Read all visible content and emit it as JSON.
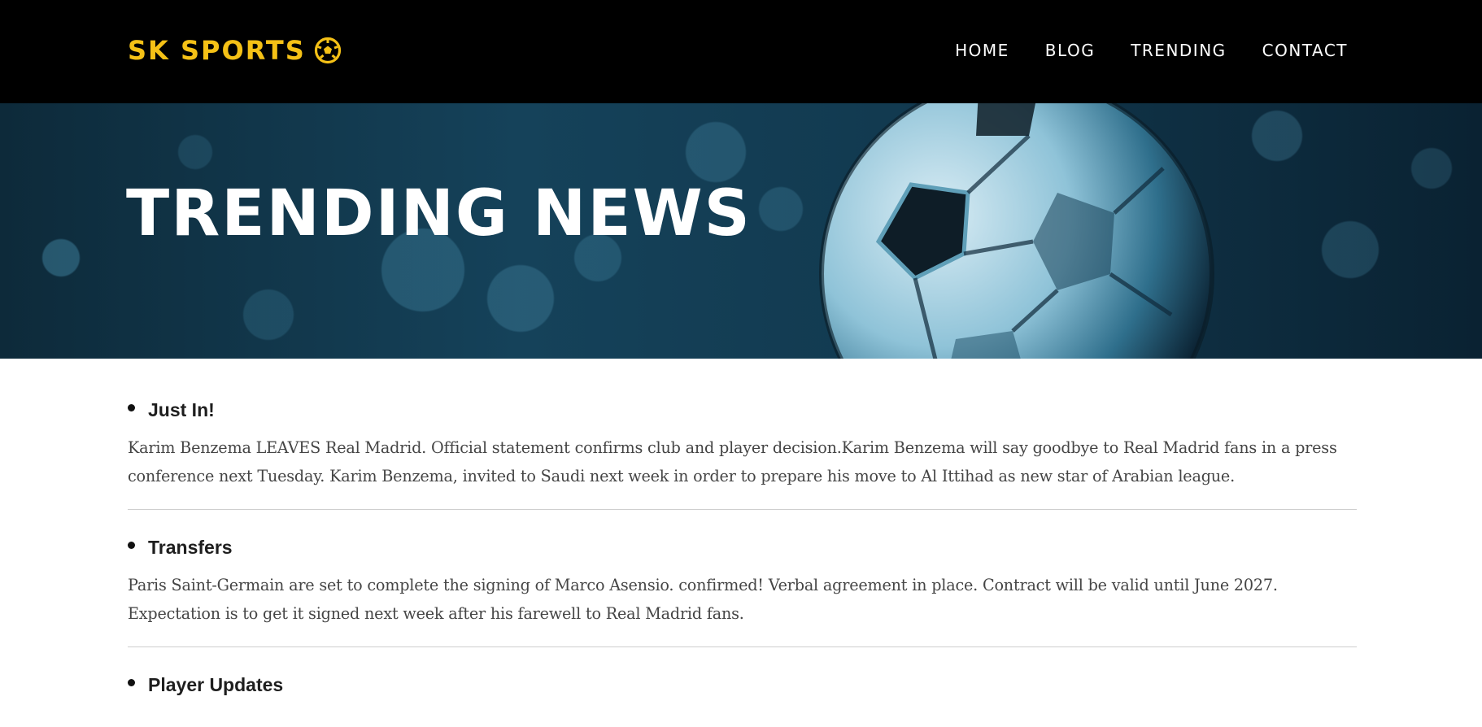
{
  "brand": {
    "name": "SK SPORTS",
    "icon": "soccer-ball-icon",
    "color": "#f5c116"
  },
  "nav": {
    "items": [
      {
        "label": "HOME"
      },
      {
        "label": "BLOG"
      },
      {
        "label": "TRENDING"
      },
      {
        "label": "CONTACT"
      }
    ]
  },
  "hero": {
    "title": "TRENDING NEWS",
    "image": "soccer-ball-image"
  },
  "news": [
    {
      "heading": "Just In!",
      "body": "Karim Benzema LEAVES Real Madrid. Official statement confirms club and player decision.Karim Benzema will say goodbye to Real Madrid fans in a press conference next Tuesday. Karim Benzema, invited to Saudi next week in order to prepare his move to Al Ittihad as new star of Arabian league."
    },
    {
      "heading": "Transfers",
      "body": "Paris Saint-Germain are set to complete the signing of Marco Asensio. confirmed! Verbal agreement in place. Contract will be valid until June 2027. Expectation is to get it signed next week after his farewell to Real Madrid fans."
    },
    {
      "heading": "Player Updates",
      "body": ""
    }
  ]
}
